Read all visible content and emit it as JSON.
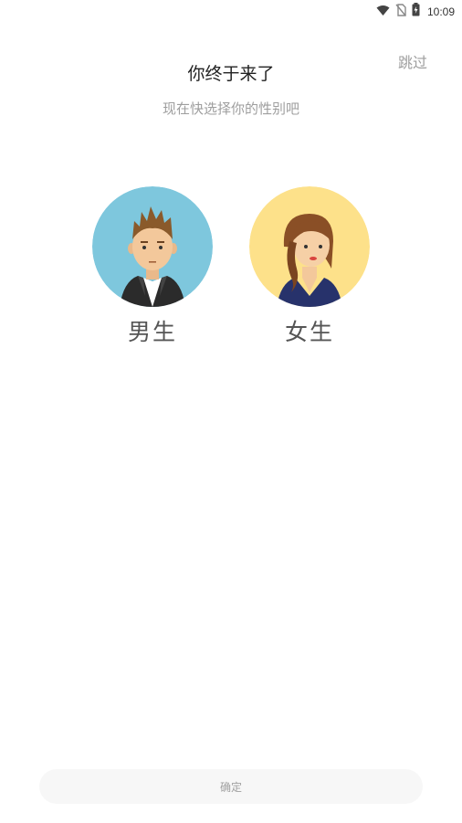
{
  "status_bar": {
    "time": "10:09",
    "icons": [
      "wifi-icon",
      "no-sim-icon",
      "battery-charging-icon"
    ]
  },
  "header": {
    "skip_label": "跳过",
    "title": "你终于来了",
    "subtitle": "现在快选择你的性别吧"
  },
  "genders": [
    {
      "label": "男生",
      "avatar": "male-avatar",
      "bg_color": "#7ec7dd"
    },
    {
      "label": "女生",
      "avatar": "female-avatar",
      "bg_color": "#fde18a"
    }
  ],
  "footer": {
    "confirm_label": "确定"
  }
}
